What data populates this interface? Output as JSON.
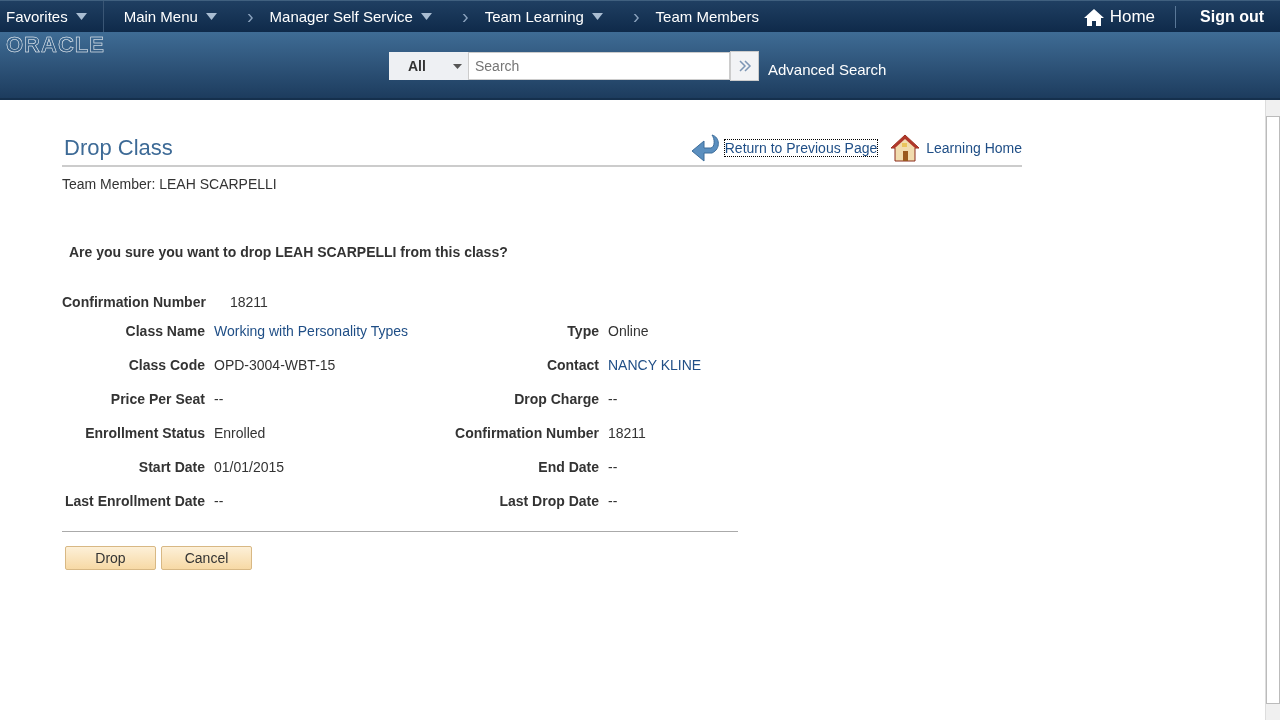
{
  "nav": {
    "items": [
      {
        "label": "Favorites",
        "dropdown": true
      },
      {
        "label": "Main Menu",
        "dropdown": true
      },
      {
        "label": "Manager Self Service",
        "dropdown": true,
        "separator": "›"
      },
      {
        "label": "Team Learning",
        "dropdown": true,
        "separator": "›"
      },
      {
        "label": "Team Members",
        "dropdown": false,
        "separator": "›"
      }
    ],
    "home": "Home",
    "signout": "Sign out"
  },
  "banner": {
    "logo": "ORACLE",
    "search_scope": "All",
    "search_placeholder": "Search",
    "advanced": "Advanced Search"
  },
  "page": {
    "title": "Drop Class",
    "return_link": "Return to Previous Page",
    "learning_home": "Learning Home",
    "team_member": "Team Member: LEAH SCARPELLI",
    "question": "Are you sure you want to drop LEAH SCARPELLI from this class?",
    "confirmation": {
      "label": "Confirmation Number",
      "value": "18211"
    },
    "rows": [
      {
        "left": {
          "label": "Class Name",
          "value": "Working with Personality Types",
          "link": true
        },
        "right": {
          "label": "Type",
          "value": "Online",
          "link": false
        }
      },
      {
        "left": {
          "label": "Class Code",
          "value": "OPD-3004-WBT-15",
          "link": false
        },
        "right": {
          "label": "Contact",
          "value": "NANCY KLINE",
          "link": true
        }
      },
      {
        "left": {
          "label": "Price Per Seat",
          "value": "--",
          "link": false
        },
        "right": {
          "label": "Drop Charge",
          "value": "--",
          "link": false
        }
      },
      {
        "left": {
          "label": "Enrollment Status",
          "value": "Enrolled",
          "link": false
        },
        "right": {
          "label": "Confirmation Number",
          "value": "18211",
          "link": false
        }
      },
      {
        "left": {
          "label": "Start Date",
          "value": "01/01/2015",
          "link": false
        },
        "right": {
          "label": "End Date",
          "value": "--",
          "link": false
        }
      },
      {
        "left": {
          "label": "Last Enrollment Date",
          "value": "--",
          "link": false
        },
        "right": {
          "label": "Last Drop Date",
          "value": "--",
          "link": false
        }
      }
    ],
    "buttons": [
      "Drop",
      "Cancel"
    ]
  }
}
